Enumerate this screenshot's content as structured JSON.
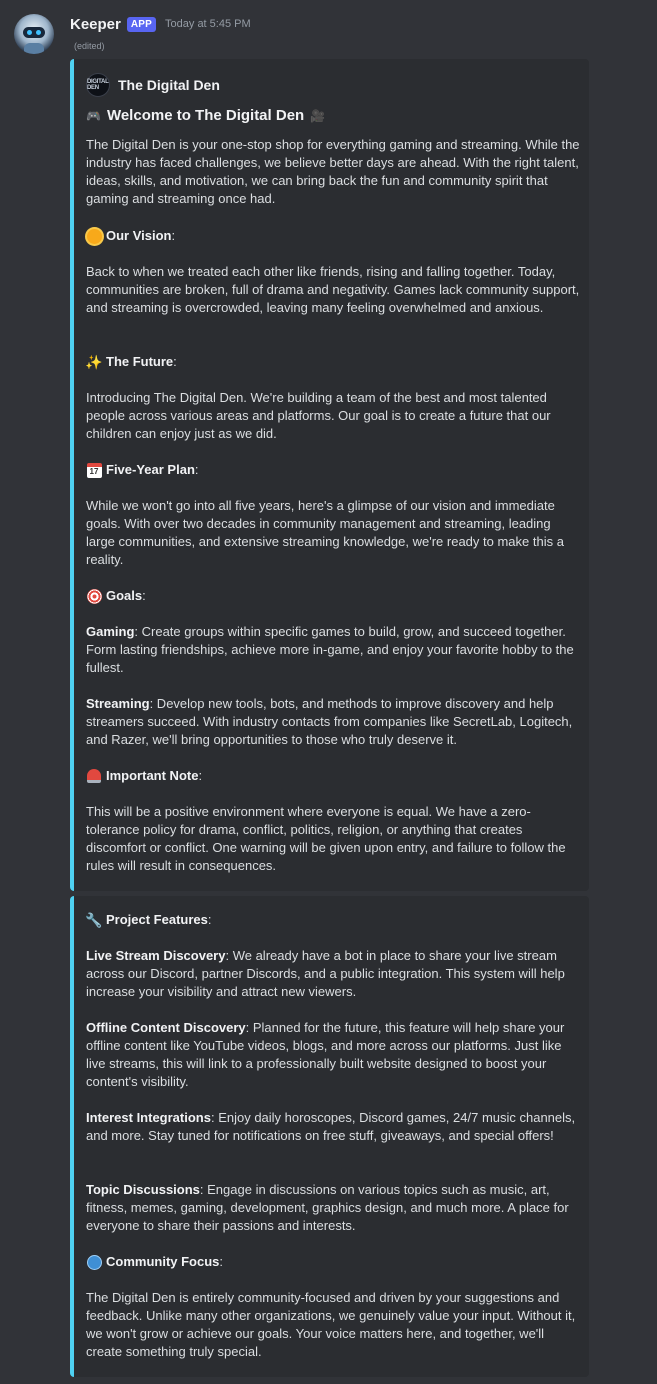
{
  "message": {
    "username": "Keeper",
    "badge": "APP",
    "timestamp": "Today at 5:45 PM",
    "edited": "(edited)"
  },
  "embed1": {
    "author": "The Digital Den",
    "author_icon_text": "DIGITAL DEN",
    "title": "Welcome to The Digital Den",
    "intro": "The Digital Den is your one-stop shop for everything gaming and streaming. While the industry has faced challenges, we believe better days are ahead. With the right talent, ideas, skills, and motivation, we can bring back the fun and community spirit that gaming and streaming once had.",
    "vision_heading": "Our Vision",
    "vision_text": "Back to when we treated each other like friends, rising and falling together. Today, communities are broken, full of drama and negativity. Games lack community support, and streaming is overcrowded, leaving many feeling overwhelmed and anxious.",
    "future_heading": "The Future",
    "future_text": "Introducing The Digital Den. We're building a team of the best and most talented people across various areas and platforms. Our goal is to create a future that our children can enjoy just as we did.",
    "plan_heading": "Five-Year Plan",
    "plan_text": "While we won't go into all five years, here's a glimpse of our vision and immediate goals. With over two decades in community management and streaming, leading large communities, and extensive streaming knowledge, we're ready to make this a reality.",
    "goals_heading": "Goals",
    "gaming_label": "Gaming",
    "gaming_text": ": Create groups within specific games to build, grow, and succeed together. Form lasting friendships, achieve more in-game, and enjoy your favorite hobby to the fullest.",
    "streaming_label": "Streaming",
    "streaming_text": ": Develop new tools, bots, and methods to improve discovery and help streamers succeed. With industry contacts from companies like SecretLab, Logitech, and Razer, we'll bring opportunities to those who truly deserve it.",
    "note_heading": "Important Note",
    "note_text": "This will be a positive environment where everyone is equal. We have a zero-tolerance policy for drama, conflict, politics, religion, or anything that creates discomfort or conflict. One warning will be given upon entry, and failure to follow the rules will result in consequences."
  },
  "embed2": {
    "features_heading": "Project Features",
    "live_label": "Live Stream Discovery",
    "live_text": ": We already have a bot in place to share your live stream across our Discord, partner Discords, and a public integration. This system will help increase your visibility and attract new viewers.",
    "offline_label": "Offline Content Discovery",
    "offline_text": ": Planned for the future, this feature will help share your offline content like YouTube videos, blogs, and more across our platforms. Just like live streams, this will link to a professionally built website designed to boost your content's visibility.",
    "interest_label": "Interest Integrations",
    "interest_text": ": Enjoy daily horoscopes, Discord games, 24/7 music channels, and more. Stay tuned for notifications on free stuff, giveaways, and special offers!",
    "topic_label": "Topic Discussions",
    "topic_text": ": Engage in discussions on various topics such as music, art, fitness, memes, gaming, development, graphics design, and much more. A place for everyone to share their passions and interests.",
    "community_heading": "Community Focus",
    "community_text": "The Digital Den is entirely community-focused and driven by your suggestions and feedback. Unlike many other organizations, we genuinely value your input. Without it, we won't grow or achieve our goals. Your voice matters here, and together, we'll create something truly special."
  },
  "punct": {
    "colon": ":"
  },
  "icons": {
    "sun": "sun-icon",
    "sparkles": "sparkles-icon",
    "calendar": "calendar-icon",
    "target": "target-icon",
    "siren": "siren-icon",
    "wrench": "wrench-icon",
    "globe": "globe-icon",
    "calendar_number": "17"
  },
  "colors": {
    "accent": "#4fd1f2",
    "badge": "#5865f2",
    "background": "#313338",
    "embed": "#2b2d31"
  }
}
